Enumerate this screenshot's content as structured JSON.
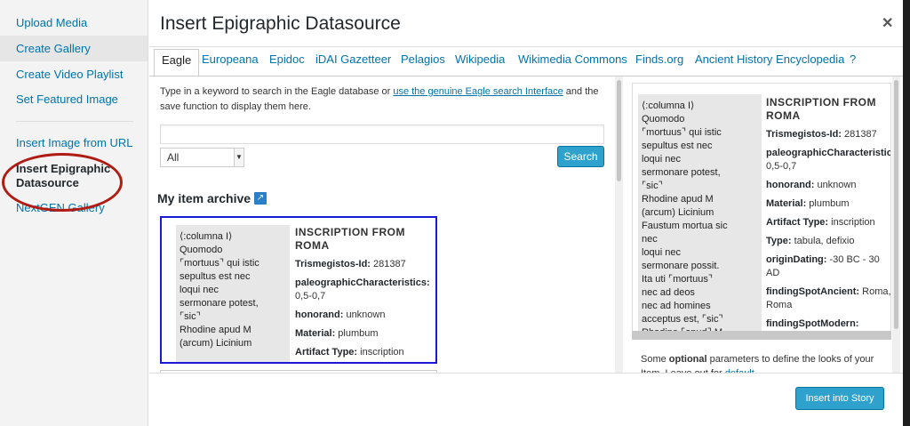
{
  "sidebar": {
    "items": [
      {
        "label": "Upload Media"
      },
      {
        "label": "Create Gallery"
      },
      {
        "label": "Create Video Playlist"
      },
      {
        "label": "Set Featured Image"
      },
      {
        "label": "Insert Image from URL"
      },
      {
        "label": "Insert Epigraphic Datasource"
      },
      {
        "label": "NextGEN Gallery"
      }
    ]
  },
  "modal": {
    "title": "Insert Epigraphic Datasource",
    "close_icon": "close-icon",
    "tabs": [
      {
        "label": "Eagle"
      },
      {
        "label": "Europeana"
      },
      {
        "label": "Epidoc"
      },
      {
        "label": "iDAI Gazetteer"
      },
      {
        "label": "Pelagios"
      },
      {
        "label": "Wikipedia"
      },
      {
        "label": "Wikimedia Commons"
      },
      {
        "label": "Finds.org"
      },
      {
        "label": "Ancient History Encyclopedia"
      },
      {
        "label": "?"
      }
    ]
  },
  "search": {
    "intro_before": "Type in a keyword to search in the Eagle database or ",
    "intro_link": "use the genuine Eagle search Interface",
    "intro_after": " and the save function to display them here.",
    "keyword_value": "",
    "filter_value": "All",
    "search_label": "Search"
  },
  "archive": {
    "heading": "My item archive",
    "card": {
      "text_lines": [
        "⟨:columna I⟩",
        "Quomodo",
        "⌜mortuus⌝ qui istic",
        "sepultus est nec",
        "loqui nec",
        "sermonare potest,",
        "⌜sic⌝",
        "Rhodine apud M",
        "(arcum) Licinium"
      ],
      "title": "INSCRIPTION FROM ROMA",
      "fields": [
        {
          "label": "Trismegistos-Id:",
          "value": " 281387"
        },
        {
          "label": "paleographicCharacteristics:",
          "value": " 0,5-0,7"
        },
        {
          "label": "honorand:",
          "value": " unknown"
        },
        {
          "label": "Material:",
          "value": " plumbum"
        },
        {
          "label": "Artifact Type:",
          "value": " inscription"
        }
      ]
    }
  },
  "preview": {
    "text_lines": [
      "⟨:columna I⟩",
      "Quomodo",
      "⌜mortuus⌝ qui istic",
      "sepultus est nec",
      "loqui nec",
      "sermonare potest,",
      "⌜sic⌝",
      "Rhodine apud M",
      "(arcum) Licinium",
      "Faustum mortua sic",
      "nec",
      "loqui nec",
      "sermonare possit.",
      "Ita uti ⌜mortuus⌝",
      "nec ad deos",
      "nec ad homines",
      "acceptus est, ⌜sic⌝",
      "Rhodine ⌜apud⌝ M"
    ],
    "title": "INSCRIPTION FROM ROMA",
    "fields": [
      {
        "label": "Trismegistos-Id:",
        "value": " 281387"
      },
      {
        "label": "paleographicCharacteristics:",
        "value": " 0,5-0,7"
      },
      {
        "label": "honorand:",
        "value": " unknown"
      },
      {
        "label": "Material:",
        "value": " plumbum"
      },
      {
        "label": "Artifact Type:",
        "value": " inscription"
      },
      {
        "label": "Type:",
        "value": " tabula, defixio"
      },
      {
        "label": "originDating:",
        "value": " -30 BC - 30 AD"
      },
      {
        "label": "findingSpotAncient:",
        "value": " Roma, Roma"
      },
      {
        "label": "findingSpotModern:",
        "value": ""
      }
    ],
    "options_before": "Some ",
    "options_bold": "optional",
    "options_after": " parameters to define the looks of your Item. Leave out for ",
    "options_link": "default"
  },
  "footer": {
    "insert_label": "Insert into Story"
  },
  "colors": {
    "accent": "#2ea2cc",
    "link": "#0073aa",
    "highlight_circle": "#b01c14",
    "card_border": "#1a1ad6"
  }
}
